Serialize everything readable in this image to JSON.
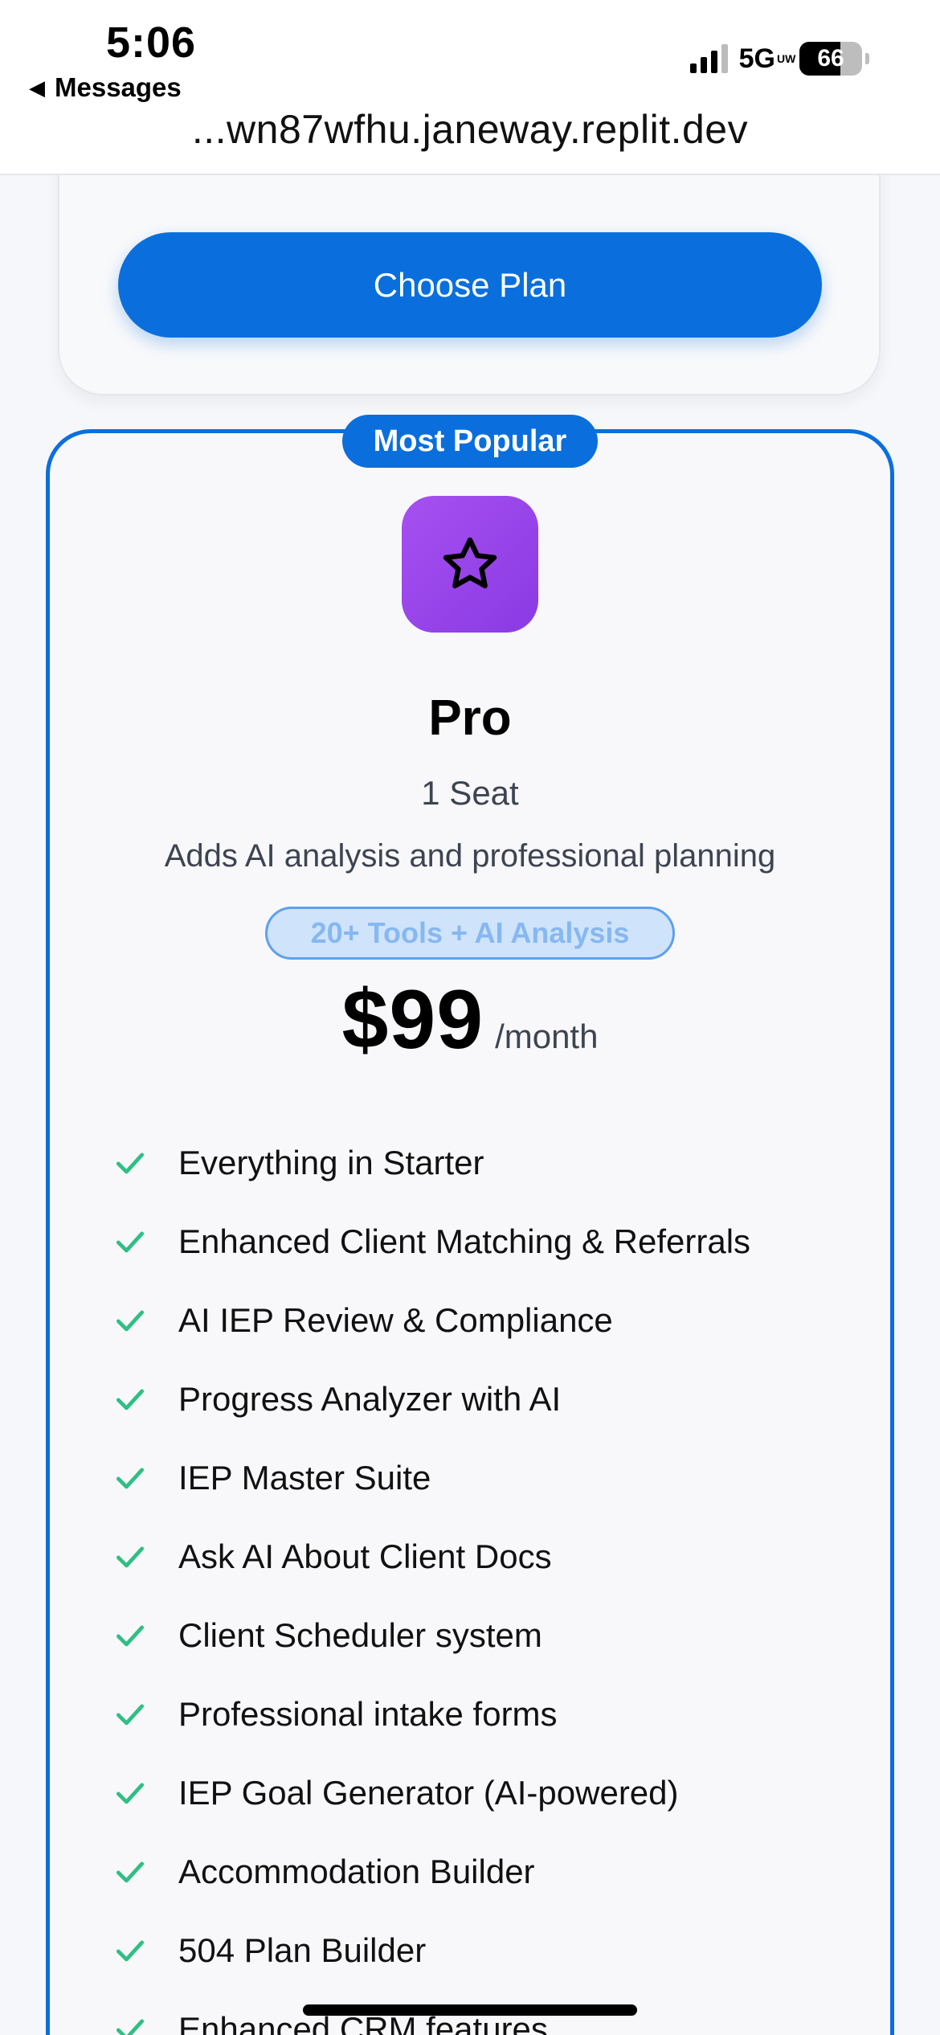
{
  "status_bar": {
    "time": "5:06",
    "back_label": "Messages",
    "network": "5G",
    "network_sub": "UW",
    "battery_level": 66,
    "battery_text": "66"
  },
  "browser": {
    "url": "...wn87wfhu.janeway.replit.dev"
  },
  "previous_plan": {
    "choose_label": "Choose Plan"
  },
  "pro_plan": {
    "badge": "Most Popular",
    "icon": "star-icon",
    "name": "Pro",
    "seats": "1 Seat",
    "description": "Adds AI analysis and professional planning",
    "tools_badge": "20+ Tools + AI Analysis",
    "price": "$99",
    "period": "/month",
    "features": [
      "Everything in Starter",
      "Enhanced Client Matching & Referrals",
      "AI IEP Review & Compliance",
      "Progress Analyzer with AI",
      "IEP Master Suite",
      "Ask AI About Client Docs",
      "Client Scheduler system",
      "Professional intake forms",
      "IEP Goal Generator (AI-powered)",
      "Accommodation Builder",
      "504 Plan Builder",
      "Enhanced CRM features"
    ]
  },
  "colors": {
    "primary": "#0a6fdc",
    "star_tile": "#9b48ea",
    "check": "#2fbf85",
    "badge_bg": "#cfe3fb"
  }
}
